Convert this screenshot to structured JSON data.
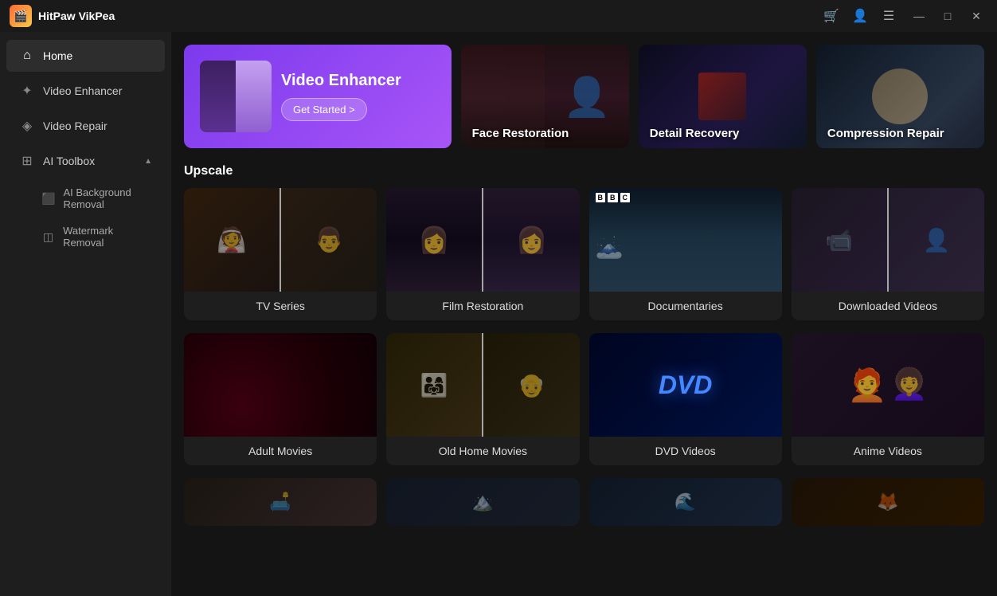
{
  "app": {
    "title": "HitPaw VikPea",
    "logo": "🎬"
  },
  "titlebar": {
    "icons": {
      "store": "🛒",
      "account": "👤",
      "menu": "☰",
      "minimize": "—",
      "maximize": "□",
      "close": "✕"
    }
  },
  "sidebar": {
    "items": [
      {
        "id": "home",
        "label": "Home",
        "icon": "⌂",
        "active": true
      },
      {
        "id": "video-enhancer",
        "label": "Video Enhancer",
        "icon": "✦"
      },
      {
        "id": "video-repair",
        "label": "Video Repair",
        "icon": "◈"
      }
    ],
    "toolbox": {
      "label": "AI Toolbox",
      "icon": "⊞",
      "expanded": true,
      "subItems": [
        {
          "id": "bg-removal",
          "label": "AI Background Removal",
          "icon": "⬛"
        },
        {
          "id": "watermark-removal",
          "label": "Watermark Removal",
          "icon": "◫"
        }
      ]
    }
  },
  "feature_cards": [
    {
      "id": "video-enhancer",
      "title": "Video Enhancer",
      "btn_label": "Get Started >",
      "type": "hero"
    },
    {
      "id": "face-restoration",
      "title": "Face Restoration",
      "type": "feature"
    },
    {
      "id": "detail-recovery",
      "title": "Detail Recovery",
      "type": "feature"
    },
    {
      "id": "compression-repair",
      "title": "Compression Repair",
      "type": "feature"
    }
  ],
  "sections": [
    {
      "id": "upscale",
      "title": "Upscale",
      "cards": [
        {
          "id": "tv-series",
          "label": "TV Series"
        },
        {
          "id": "film-restoration",
          "label": "Film Restoration"
        },
        {
          "id": "documentaries",
          "label": "Documentaries"
        },
        {
          "id": "downloaded-videos",
          "label": "Downloaded Videos"
        },
        {
          "id": "adult-movies",
          "label": "Adult Movies"
        },
        {
          "id": "old-home-movies",
          "label": "Old Home Movies"
        },
        {
          "id": "dvd-videos",
          "label": "DVD Videos"
        },
        {
          "id": "anime-videos",
          "label": "Anime Videos"
        }
      ]
    }
  ],
  "bottom_cards": [
    {
      "id": "bottom-1"
    },
    {
      "id": "bottom-2"
    },
    {
      "id": "bottom-3"
    },
    {
      "id": "bottom-4"
    }
  ]
}
